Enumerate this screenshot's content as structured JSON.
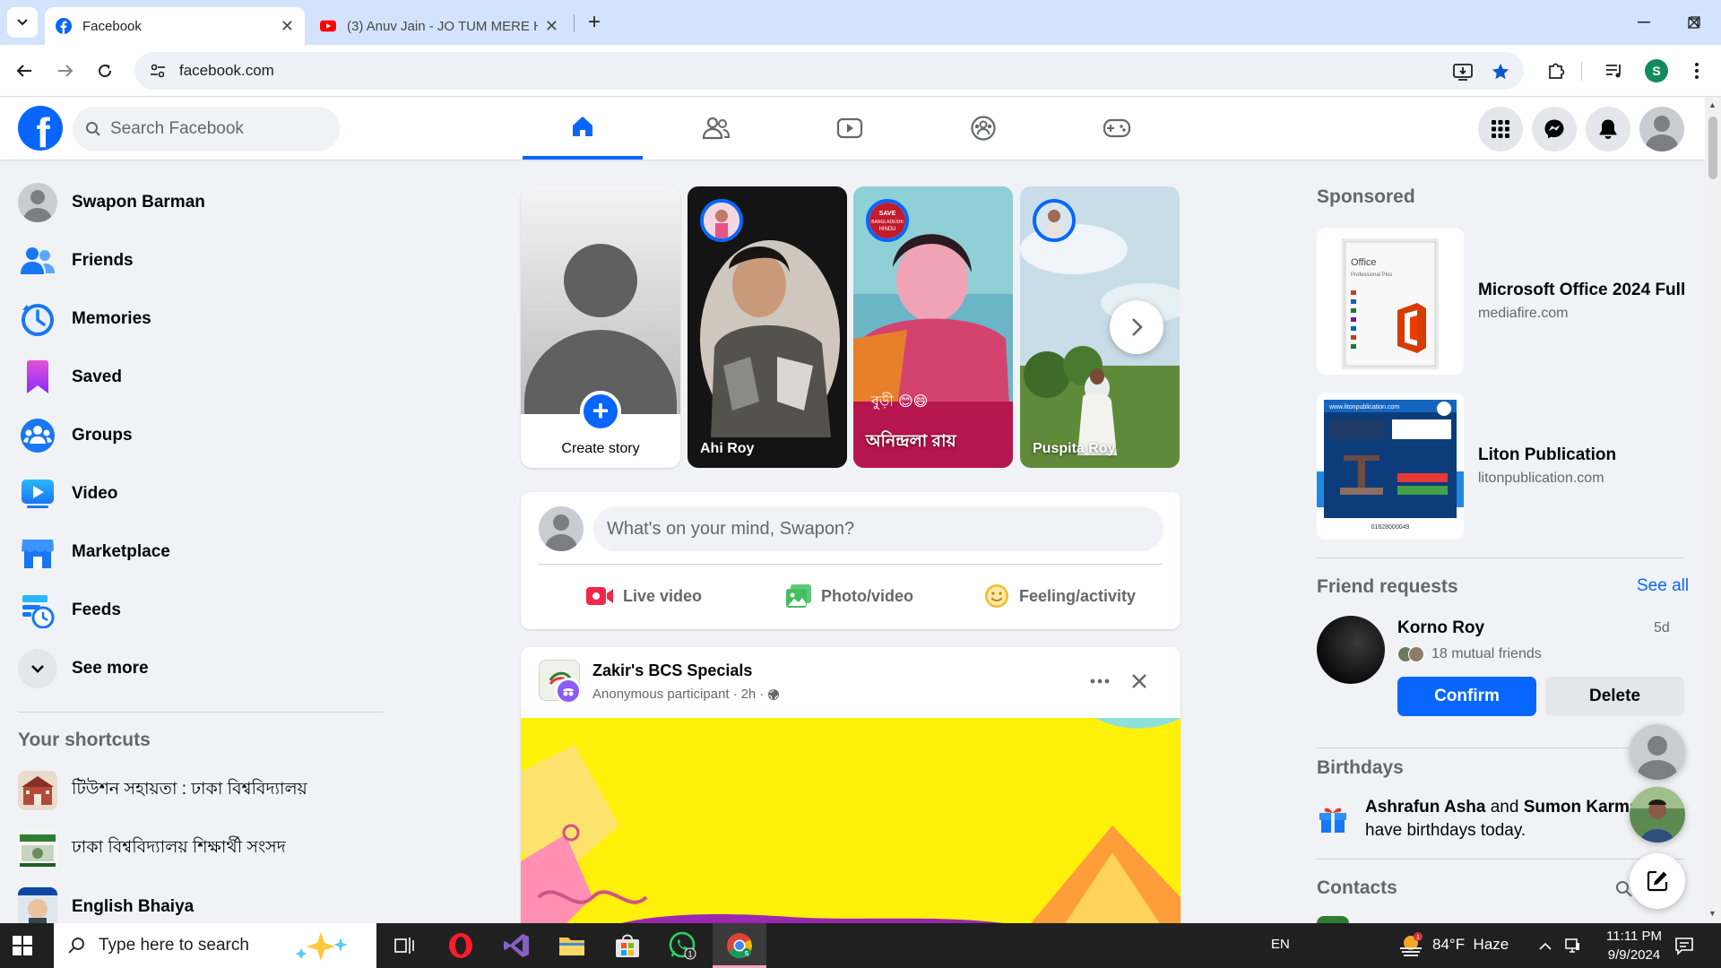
{
  "browser": {
    "tabs": [
      {
        "title": "Facebook",
        "active": true
      },
      {
        "title": "(3) Anuv Jain - JO TUM MERE H",
        "active": false
      }
    ],
    "url": "facebook.com",
    "profile_initial": "S"
  },
  "fb": {
    "search_placeholder": "Search Facebook",
    "brand_color": "#0866ff",
    "logo_letter": "f",
    "nav_tabs": [
      "home-icon",
      "friends-icon",
      "watch-icon",
      "groups-icon",
      "gaming-icon"
    ],
    "header_actions": [
      "menu-icon",
      "messenger-icon",
      "bell-icon",
      "account-icon"
    ]
  },
  "sidebar": {
    "items": [
      {
        "label": "Swapon Barman"
      },
      {
        "label": "Friends"
      },
      {
        "label": "Memories"
      },
      {
        "label": "Saved"
      },
      {
        "label": "Groups"
      },
      {
        "label": "Video"
      },
      {
        "label": "Marketplace"
      },
      {
        "label": "Feeds"
      },
      {
        "label": "See more"
      }
    ],
    "shortcuts_title": "Your shortcuts",
    "shortcuts": [
      {
        "label": "টিউশন সহায়তা : ঢাকা বিশ্ববিদ্যালয়"
      },
      {
        "label": "ঢাকা বিশ্ববিদ্যালয় শিক্ষার্থী সংসদ"
      },
      {
        "label": "English Bhaiya"
      }
    ]
  },
  "stories": {
    "create_label": "Create story",
    "items": [
      {
        "name": "Ahi Roy"
      },
      {
        "name": "অনিন্দ্রলা রায়"
      },
      {
        "name": "Puspita Roy"
      }
    ]
  },
  "composer": {
    "placeholder": "What's on your mind, Swapon?",
    "actions": [
      "Live video",
      "Photo/video",
      "Feeling/activity"
    ]
  },
  "post": {
    "group": "Zakir's BCS Specials",
    "author": "Anonymous participant",
    "time": "2h",
    "sep": "·"
  },
  "right": {
    "sponsored_title": "Sponsored",
    "ads": [
      {
        "title": "Microsoft Office 2024 Full",
        "domain": "mediafire.com"
      },
      {
        "title": "Liton Publication",
        "domain": "litonpublication.com"
      }
    ],
    "friend_requests_title": "Friend requests",
    "see_all": "See all",
    "request": {
      "name": "Korno Roy",
      "age": "5d",
      "mutual": "18 mutual friends",
      "confirm": "Confirm",
      "delete": "Delete"
    },
    "birthdays_title": "Birthdays",
    "birthday": {
      "name1": "Ashrafun Asha",
      "and": "and",
      "name2": "Sumon Karmak",
      "rest": "have birthdays today."
    },
    "contacts_title": "Contacts"
  },
  "taskbar": {
    "search_placeholder": "Type here to search",
    "lang": "EN",
    "weather": "84°F  Haze",
    "time": "11:11 PM",
    "date": "9/9/2024",
    "whatsapp_badge": "1"
  }
}
